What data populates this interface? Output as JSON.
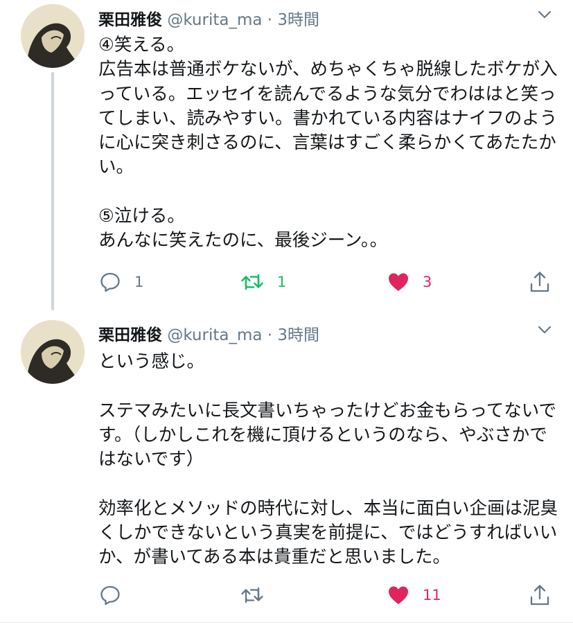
{
  "tweets": [
    {
      "author": "栗田雅俊",
      "handle": "@kurita_ma",
      "separator": "·",
      "time": "3時間",
      "text": "④笑える。\n広告本は普通ボケないが、めちゃくちゃ脱線したボケが入っている。エッセイを読んでるような気分でわははと笑ってしまい、読みやすい。書かれている内容はナイフのように心に突き刺さるのに、言葉はすごく柔らかくてあたたかい。\n\n⑤泣ける。\nあんなに笑えたのに、最後ジーン。。",
      "replies": "1",
      "retweets": "1",
      "likes": "3",
      "retweeted": true,
      "liked": true
    },
    {
      "author": "栗田雅俊",
      "handle": "@kurita_ma",
      "separator": "·",
      "time": "3時間",
      "text": "という感じ。\n\nステマみたいに長文書いちゃったけどお金もらってないです。（しかしこれを機に頂けるというのなら、やぶさかではないです）\n\n効率化とメソッドの時代に対し、本当に面白い企画は泥臭くしかできないという真実を前提に、ではどうすればいいか、が書いてある本は貴重だと思いました。",
      "replies": "",
      "retweets": "",
      "likes": "11",
      "retweeted": false,
      "liked": true
    }
  ],
  "colors": {
    "text": "#14171a",
    "meta": "#657786",
    "retweet_active": "#17bf63",
    "like_active": "#e0245e",
    "thread_line": "#ccd6dd"
  },
  "icons": [
    "reply-icon",
    "retweet-icon",
    "like-icon",
    "share-icon",
    "chevron-down-icon"
  ]
}
